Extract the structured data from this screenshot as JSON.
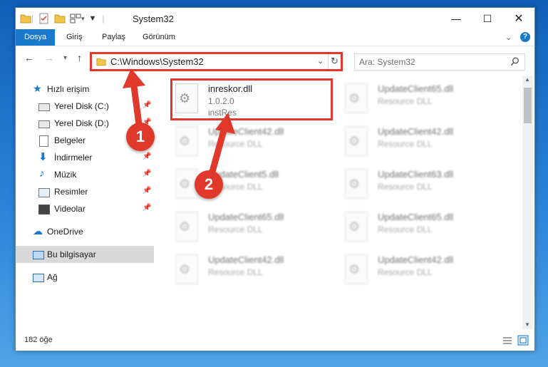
{
  "window": {
    "title": "System32"
  },
  "ribbon": {
    "tabs": [
      "Dosya",
      "Giriş",
      "Paylaş",
      "Görünüm"
    ]
  },
  "address": {
    "path": "C:\\Windows\\System32"
  },
  "search": {
    "placeholder": "Ara: System32"
  },
  "sidebar": {
    "items": [
      {
        "label": "Hızlı erişim",
        "pinned": false
      },
      {
        "label": "Yerel Disk (C:)",
        "pinned": true
      },
      {
        "label": "Yerel Disk (D:)",
        "pinned": true
      },
      {
        "label": "Belgeler",
        "pinned": false
      },
      {
        "label": "İndirmeler",
        "pinned": true
      },
      {
        "label": "Müzik",
        "pinned": true
      },
      {
        "label": "Resimler",
        "pinned": true
      },
      {
        "label": "Videolar",
        "pinned": true
      },
      {
        "label": "OneDrive",
        "pinned": false
      },
      {
        "label": "Bu bilgisayar",
        "pinned": false,
        "selected": true
      },
      {
        "label": "Ağ",
        "pinned": false
      }
    ]
  },
  "files": [
    {
      "name": "inreskor.dll",
      "line2": "1.0.2.0",
      "line3": "instRes",
      "highlighted": true
    },
    {
      "name": "UpdateClient65.dll",
      "line2": "Resource DLL"
    },
    {
      "name": "UpdateClient42.dll",
      "line2": "Resource DLL"
    },
    {
      "name": "UpdateClient42.dll",
      "line2": "Resource DLL"
    },
    {
      "name": "UpdateClient5.dll",
      "line2": "Resource DLL"
    },
    {
      "name": "UpdateClient63.dll",
      "line2": "Resource DLL"
    },
    {
      "name": "UpdateClient65.dll",
      "line2": "Resource DLL"
    },
    {
      "name": "UpdateClient65.dll",
      "line2": "Resource DLL"
    },
    {
      "name": "UpdateClient42.dll",
      "line2": "Resource DLL"
    },
    {
      "name": "UpdateClient42.dll",
      "line2": "Resource DLL"
    }
  ],
  "status": {
    "count": "182 öğe"
  },
  "callouts": [
    "1",
    "2"
  ],
  "colors": {
    "accent": "#1979ca",
    "annotation": "#e0392b"
  }
}
